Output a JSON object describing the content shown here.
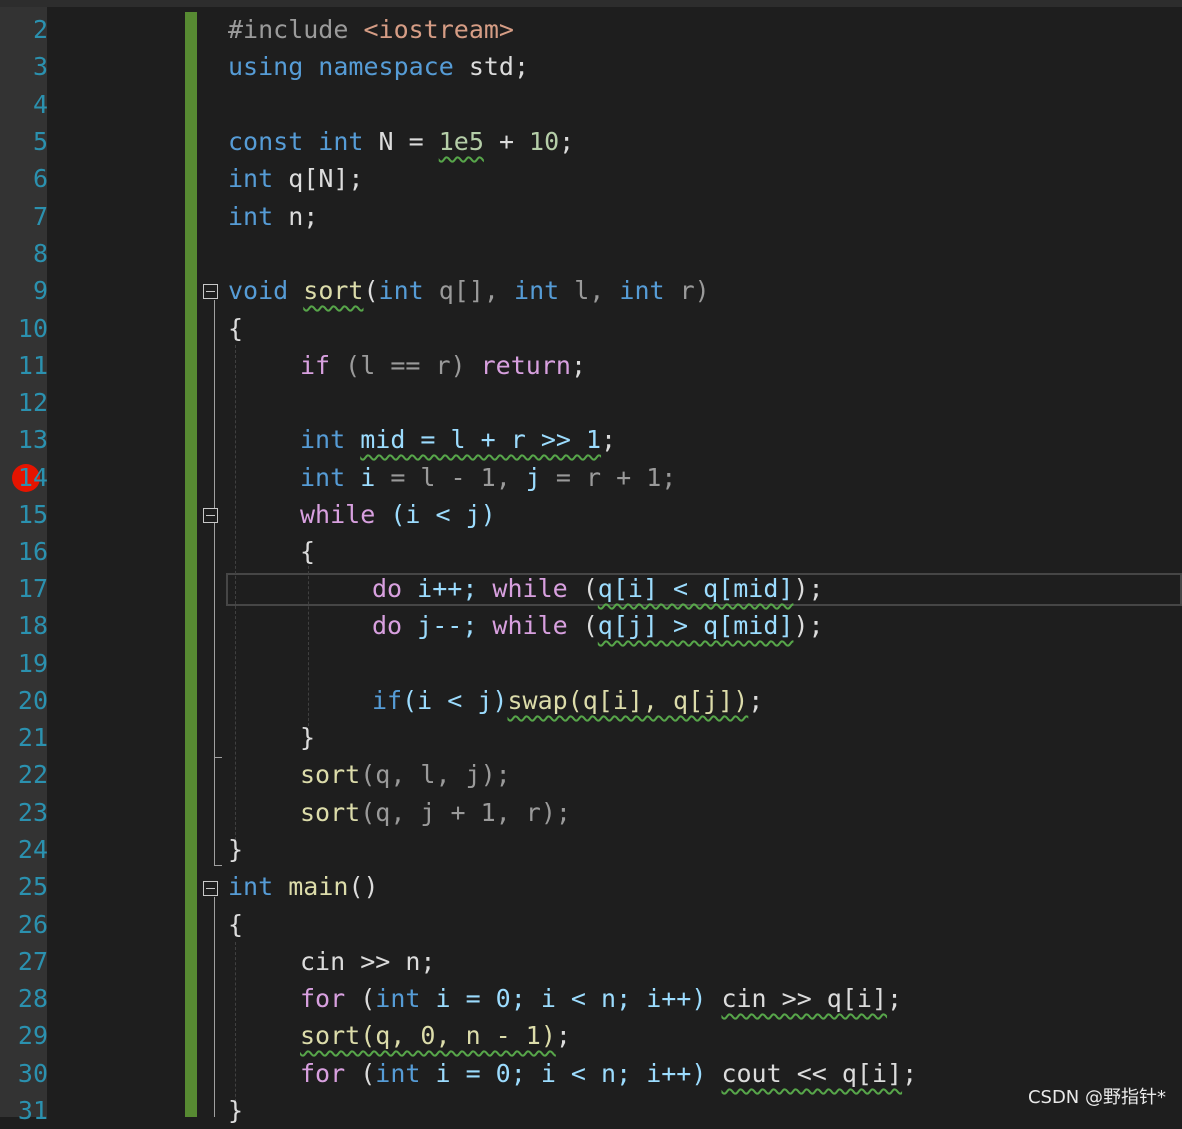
{
  "editor": {
    "line_numbers": [
      "2",
      "3",
      "4",
      "5",
      "6",
      "7",
      "8",
      "9",
      "10",
      "11",
      "12",
      "13",
      "14",
      "15",
      "16",
      "17",
      "18",
      "19",
      "20",
      "21",
      "22",
      "23",
      "24",
      "25",
      "26",
      "27",
      "28",
      "29",
      "30",
      "31"
    ],
    "breakpoint_line": "14",
    "current_line": "17"
  },
  "code": {
    "l2_a": "#include ",
    "l2_b": "<iostream>",
    "l3_a": "using namespace ",
    "l3_b": "std",
    "l5_a": "const int ",
    "l5_b": "N",
    "l5_c": " = ",
    "l5_d": "1e5",
    "l5_e": " + ",
    "l5_f": "10",
    "l6_a": "int ",
    "l6_b": "q[N];",
    "l7_a": "int ",
    "l7_b": "n;",
    "l9_a": "void ",
    "l9_b": "sort",
    "l9_c": "(",
    "l9_d": "int",
    "l9_e": " q[], ",
    "l9_f": "int",
    "l9_g": " l, ",
    "l9_h": "int",
    "l9_i": " r)",
    "l10": "{",
    "l11_a": "if",
    "l11_b": " (l == r) ",
    "l11_c": "return",
    "l13_a": "int ",
    "l13_b": "mid = l + r >> 1",
    "l14_a": "int ",
    "l14_b": "i",
    "l14_c": " = l - 1, ",
    "l14_d": "j",
    "l14_e": " = r + 1;",
    "l15_a": "while",
    "l15_b": " (i < j)",
    "l16": "{",
    "l17_a": "do",
    "l17_b": " i++; ",
    "l17_c": "while",
    "l17_d": " (",
    "l17_e": "q[i] < q[mid]",
    "l17_f": ");",
    "l18_a": "do",
    "l18_b": " j--; ",
    "l18_c": "while",
    "l18_d": " (",
    "l18_e": "q[j] > q[mid]",
    "l18_f": ");",
    "l20_a": "if",
    "l20_b": "(i < j)",
    "l20_c": "swap(q[i], q[j])",
    "l20_d": ";",
    "l21": "}",
    "l22_a": "sort",
    "l22_b": "(q, l, j);",
    "l23_a": "sort",
    "l23_b": "(q, j + 1, r);",
    "l24": "}",
    "l25_a": "int ",
    "l25_b": "main",
    "l25_c": "()",
    "l26": "{",
    "l27": "cin >> n;",
    "l28_a": "for",
    "l28_b": " (",
    "l28_c": "int",
    "l28_d": " i = 0; i < n; i++) ",
    "l28_e": "cin >> q[i]",
    "l28_f": ";",
    "l29_a": "sort(q, 0, n - 1)",
    "l29_b": ";",
    "l30_a": "for",
    "l30_b": " (",
    "l30_c": "int",
    "l30_d": " i = 0; i < n; i++) ",
    "l30_e": "cout << q[i]",
    "l30_f": ";",
    "l31": "}"
  },
  "watermark": "CSDN @野指针*",
  "colors": {
    "keyword": "#569cd6",
    "control": "#d8a0df",
    "function": "#dcdcaa",
    "number": "#b5cea8",
    "line_number": "#2b91af",
    "change_bar": "#578a32",
    "breakpoint": "#e51400"
  }
}
